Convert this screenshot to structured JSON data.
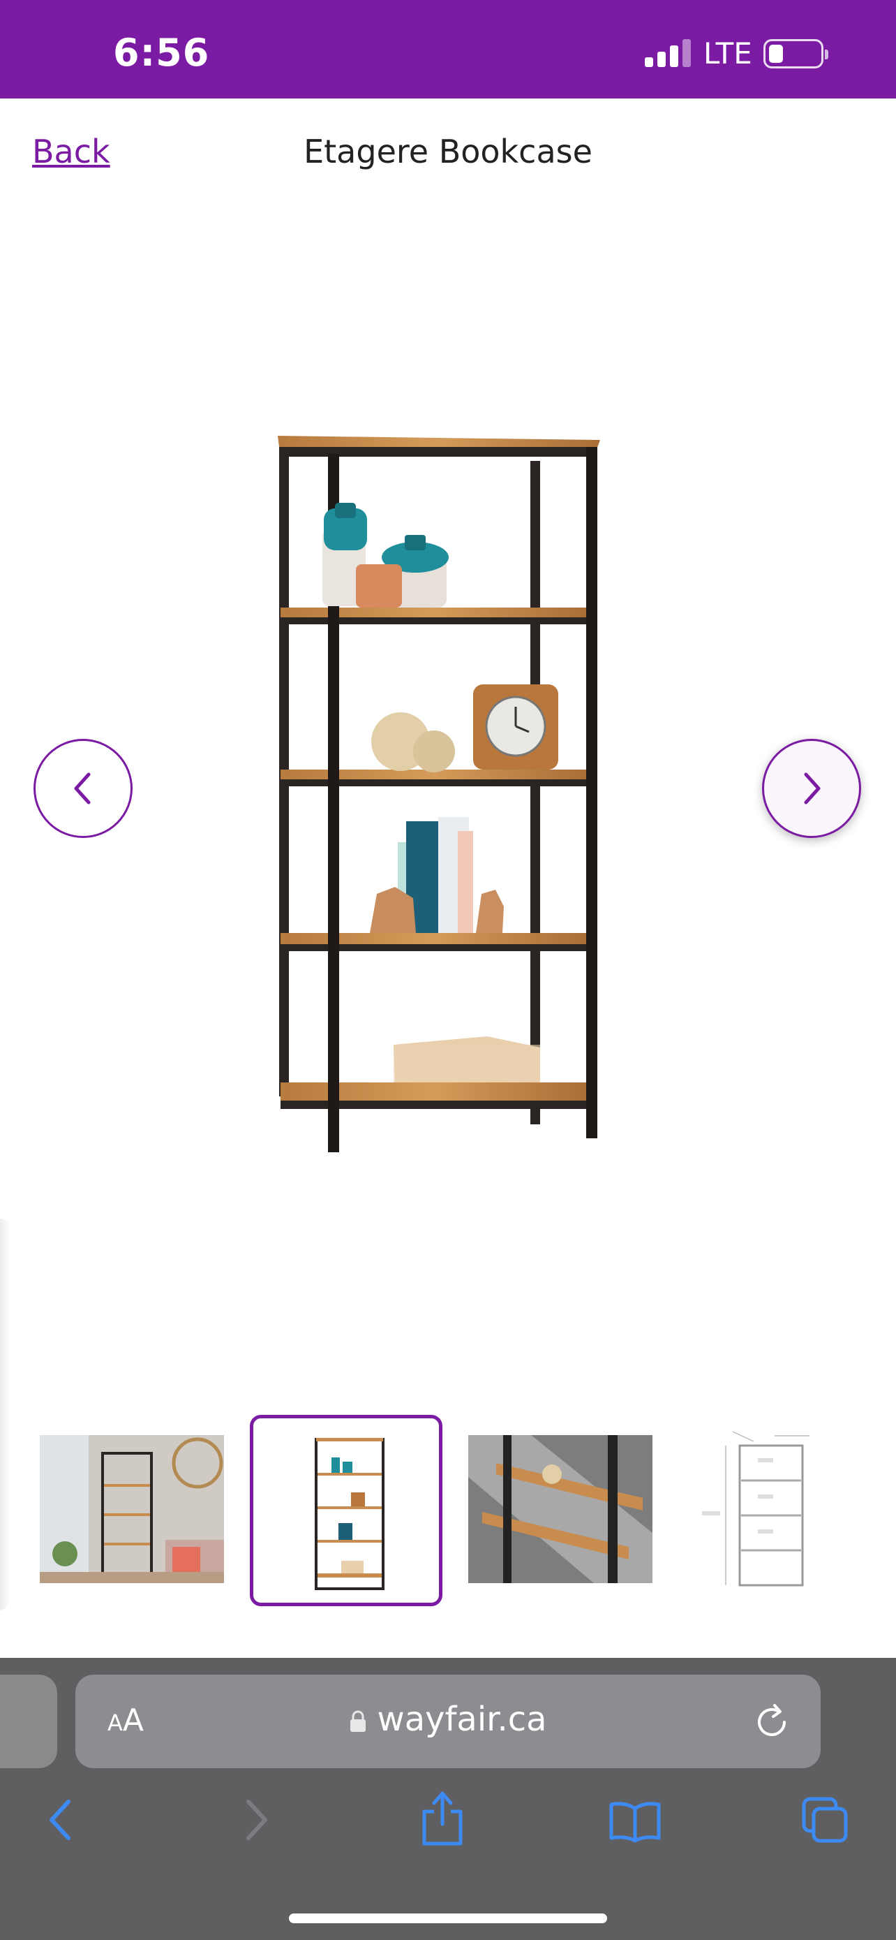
{
  "status_bar": {
    "time": "6:56",
    "network": "LTE",
    "background_color": "#7b1ba3"
  },
  "header": {
    "back_label": "Back",
    "title": "Etagere Bookcase"
  },
  "gallery": {
    "thumbnail_count": 4,
    "selected_index": 1
  },
  "browser": {
    "text_size_small": "A",
    "text_size_big": "A",
    "url": "wayfair.ca"
  },
  "colors": {
    "accent": "#7b1ba3",
    "safari_blue": "#3d8bf2",
    "safari_bar": "#5f5f62"
  }
}
